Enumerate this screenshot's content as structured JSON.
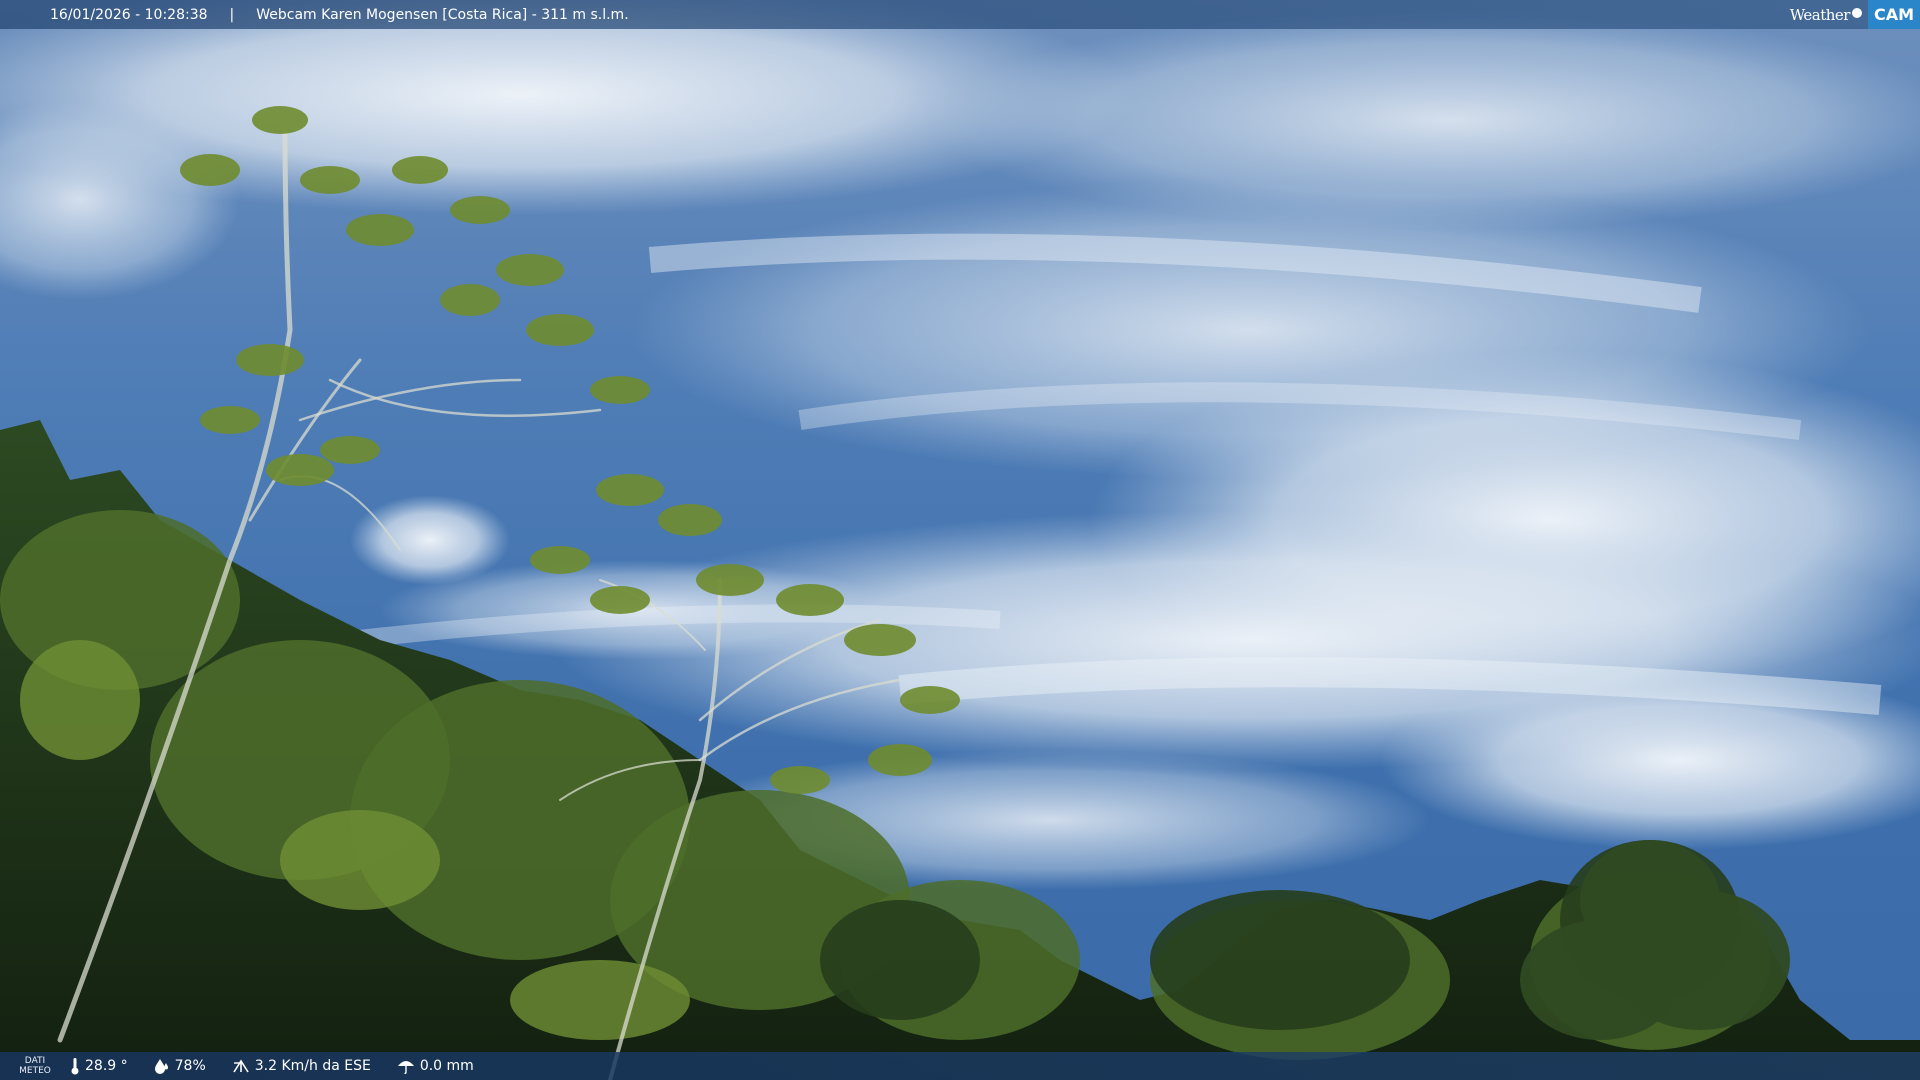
{
  "overlay_top": {
    "datetime": "16/01/2026 - 10:28:38",
    "separator": "|",
    "camera_title": "Webcam Karen Mogensen [Costa Rica] - 311 m s.l.m."
  },
  "logo": {
    "part1": "Weather",
    "part2": "CAM"
  },
  "weather_bar": {
    "label_line1": "DATI",
    "label_line2": "METEO",
    "temperature": "28.9 °",
    "humidity": "78%",
    "wind": "3.2 Km/h da ESE",
    "rain": "0.0 mm",
    "icons": [
      "thermometer-icon",
      "humidity-drop-icon",
      "wind-icon",
      "rain-umbrella-icon"
    ]
  },
  "colors": {
    "sky_top": "#7b9cc6",
    "sky_mid": "#4a79b3",
    "cloud": "#eef3f8",
    "foliage_dark": "#1c2e18",
    "foliage_light": "#8aa83c",
    "bar": "#1f4a80",
    "logo_accent": "#2a86c8"
  }
}
